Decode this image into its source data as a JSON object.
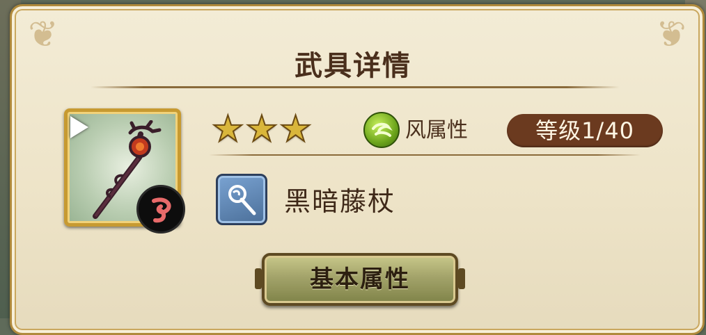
{
  "panel": {
    "title": "武具详情"
  },
  "item": {
    "rarity_stars": 3,
    "star_glyph": "★",
    "attribute_label": "风属性",
    "attribute_icon": "wind-element-icon",
    "level_text": "等级1/40",
    "type_icon": "staff-type-icon",
    "name": "黑暗藤杖"
  },
  "actions": {
    "basic_attributes_label": "基本属性"
  },
  "colors": {
    "frame_gold": "#c79a31",
    "title_brown": "#4a2f1c",
    "level_pill": "#6b3a1f",
    "wind_green": "#6da51c",
    "button_olive": "#a3a36a"
  }
}
